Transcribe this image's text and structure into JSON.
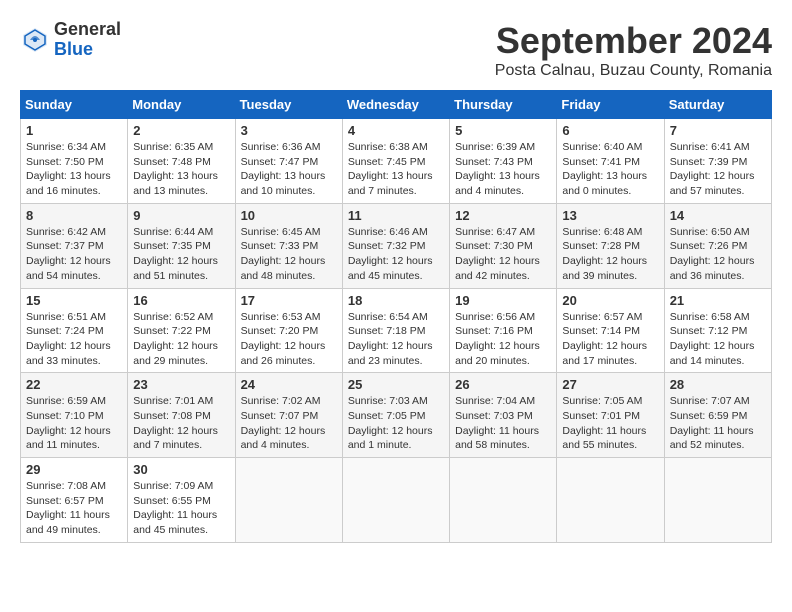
{
  "header": {
    "logo_general": "General",
    "logo_blue": "Blue",
    "month_title": "September 2024",
    "location": "Posta Calnau, Buzau County, Romania"
  },
  "weekdays": [
    "Sunday",
    "Monday",
    "Tuesday",
    "Wednesday",
    "Thursday",
    "Friday",
    "Saturday"
  ],
  "weeks": [
    [
      {
        "day": "1",
        "info": "Sunrise: 6:34 AM\nSunset: 7:50 PM\nDaylight: 13 hours and 16 minutes."
      },
      {
        "day": "2",
        "info": "Sunrise: 6:35 AM\nSunset: 7:48 PM\nDaylight: 13 hours and 13 minutes."
      },
      {
        "day": "3",
        "info": "Sunrise: 6:36 AM\nSunset: 7:47 PM\nDaylight: 13 hours and 10 minutes."
      },
      {
        "day": "4",
        "info": "Sunrise: 6:38 AM\nSunset: 7:45 PM\nDaylight: 13 hours and 7 minutes."
      },
      {
        "day": "5",
        "info": "Sunrise: 6:39 AM\nSunset: 7:43 PM\nDaylight: 13 hours and 4 minutes."
      },
      {
        "day": "6",
        "info": "Sunrise: 6:40 AM\nSunset: 7:41 PM\nDaylight: 13 hours and 0 minutes."
      },
      {
        "day": "7",
        "info": "Sunrise: 6:41 AM\nSunset: 7:39 PM\nDaylight: 12 hours and 57 minutes."
      }
    ],
    [
      {
        "day": "8",
        "info": "Sunrise: 6:42 AM\nSunset: 7:37 PM\nDaylight: 12 hours and 54 minutes."
      },
      {
        "day": "9",
        "info": "Sunrise: 6:44 AM\nSunset: 7:35 PM\nDaylight: 12 hours and 51 minutes."
      },
      {
        "day": "10",
        "info": "Sunrise: 6:45 AM\nSunset: 7:33 PM\nDaylight: 12 hours and 48 minutes."
      },
      {
        "day": "11",
        "info": "Sunrise: 6:46 AM\nSunset: 7:32 PM\nDaylight: 12 hours and 45 minutes."
      },
      {
        "day": "12",
        "info": "Sunrise: 6:47 AM\nSunset: 7:30 PM\nDaylight: 12 hours and 42 minutes."
      },
      {
        "day": "13",
        "info": "Sunrise: 6:48 AM\nSunset: 7:28 PM\nDaylight: 12 hours and 39 minutes."
      },
      {
        "day": "14",
        "info": "Sunrise: 6:50 AM\nSunset: 7:26 PM\nDaylight: 12 hours and 36 minutes."
      }
    ],
    [
      {
        "day": "15",
        "info": "Sunrise: 6:51 AM\nSunset: 7:24 PM\nDaylight: 12 hours and 33 minutes."
      },
      {
        "day": "16",
        "info": "Sunrise: 6:52 AM\nSunset: 7:22 PM\nDaylight: 12 hours and 29 minutes."
      },
      {
        "day": "17",
        "info": "Sunrise: 6:53 AM\nSunset: 7:20 PM\nDaylight: 12 hours and 26 minutes."
      },
      {
        "day": "18",
        "info": "Sunrise: 6:54 AM\nSunset: 7:18 PM\nDaylight: 12 hours and 23 minutes."
      },
      {
        "day": "19",
        "info": "Sunrise: 6:56 AM\nSunset: 7:16 PM\nDaylight: 12 hours and 20 minutes."
      },
      {
        "day": "20",
        "info": "Sunrise: 6:57 AM\nSunset: 7:14 PM\nDaylight: 12 hours and 17 minutes."
      },
      {
        "day": "21",
        "info": "Sunrise: 6:58 AM\nSunset: 7:12 PM\nDaylight: 12 hours and 14 minutes."
      }
    ],
    [
      {
        "day": "22",
        "info": "Sunrise: 6:59 AM\nSunset: 7:10 PM\nDaylight: 12 hours and 11 minutes."
      },
      {
        "day": "23",
        "info": "Sunrise: 7:01 AM\nSunset: 7:08 PM\nDaylight: 12 hours and 7 minutes."
      },
      {
        "day": "24",
        "info": "Sunrise: 7:02 AM\nSunset: 7:07 PM\nDaylight: 12 hours and 4 minutes."
      },
      {
        "day": "25",
        "info": "Sunrise: 7:03 AM\nSunset: 7:05 PM\nDaylight: 12 hours and 1 minute."
      },
      {
        "day": "26",
        "info": "Sunrise: 7:04 AM\nSunset: 7:03 PM\nDaylight: 11 hours and 58 minutes."
      },
      {
        "day": "27",
        "info": "Sunrise: 7:05 AM\nSunset: 7:01 PM\nDaylight: 11 hours and 55 minutes."
      },
      {
        "day": "28",
        "info": "Sunrise: 7:07 AM\nSunset: 6:59 PM\nDaylight: 11 hours and 52 minutes."
      }
    ],
    [
      {
        "day": "29",
        "info": "Sunrise: 7:08 AM\nSunset: 6:57 PM\nDaylight: 11 hours and 49 minutes."
      },
      {
        "day": "30",
        "info": "Sunrise: 7:09 AM\nSunset: 6:55 PM\nDaylight: 11 hours and 45 minutes."
      },
      {
        "day": "",
        "info": ""
      },
      {
        "day": "",
        "info": ""
      },
      {
        "day": "",
        "info": ""
      },
      {
        "day": "",
        "info": ""
      },
      {
        "day": "",
        "info": ""
      }
    ]
  ]
}
